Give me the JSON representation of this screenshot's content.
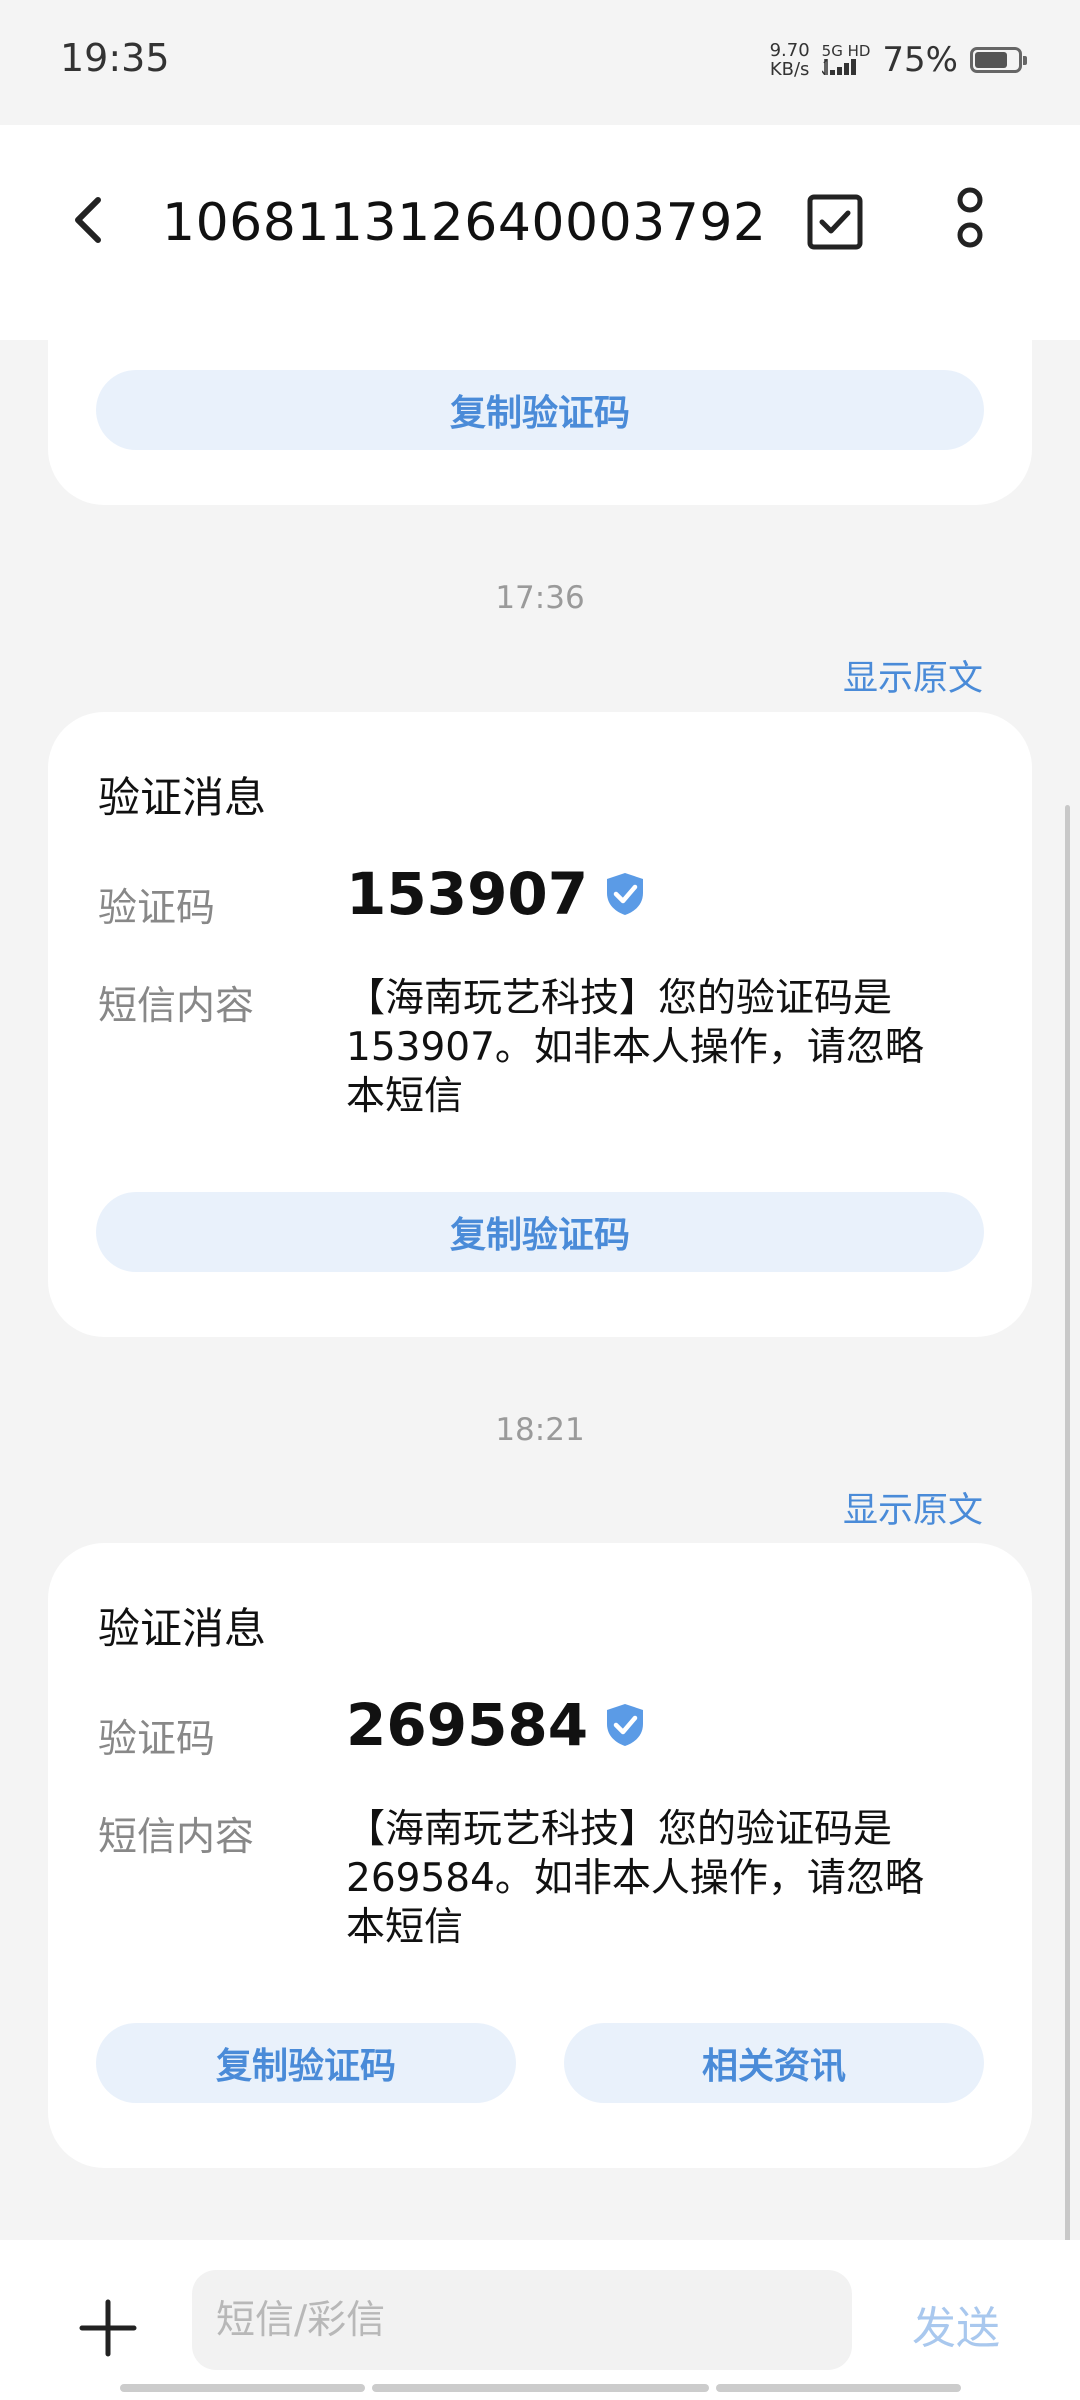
{
  "status_bar": {
    "time": "19:35",
    "net_speed_value": "9.70",
    "net_speed_unit": "KB/s",
    "net_type": "5G HD",
    "battery": "75%"
  },
  "header": {
    "title": "106811312640003792",
    "back_icon": "chevron-left-icon",
    "select_icon": "checkbox-icon",
    "more_icon": "more-vertical-icon"
  },
  "messages": [
    {
      "copy_label": "复制验证码"
    },
    {
      "timestamp": "17:36",
      "show_original": "显示原文",
      "card_title": "验证消息",
      "code_label": "验证码",
      "code": "153907",
      "content_label": "短信内容",
      "content": "【海南玩艺科技】您的验证码是153907。如非本人操作，请忽略本短信",
      "copy_label": "复制验证码"
    },
    {
      "timestamp": "18:21",
      "show_original": "显示原文",
      "card_title": "验证消息",
      "code_label": "验证码",
      "code": "269584",
      "content_label": "短信内容",
      "content": "【海南玩艺科技】您的验证码是269584。如非本人操作，请忽略本短信",
      "copy_label": "复制验证码",
      "related_label": "相关资讯"
    }
  ],
  "compose": {
    "placeholder": "短信/彩信",
    "send_label": "发送"
  },
  "colors": {
    "accent": "#4a8bd8",
    "button_bg": "#e9f1fb",
    "background": "#f4f4f4"
  }
}
